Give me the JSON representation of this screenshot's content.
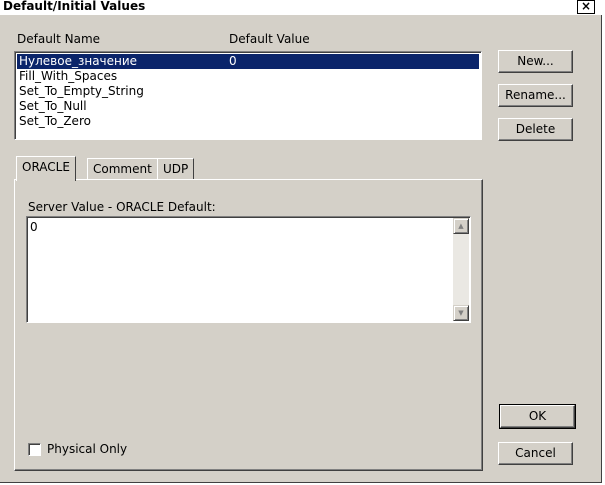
{
  "window": {
    "title": "Default/Initial Values",
    "close_glyph": "×"
  },
  "list": {
    "header_name": "Default Name",
    "header_value": "Default Value",
    "rows": [
      {
        "name": "Нулевое_значение",
        "value": "0",
        "selected": true
      },
      {
        "name": "Fill_With_Spaces",
        "value": ""
      },
      {
        "name": "Set_To_Empty_String",
        "value": ""
      },
      {
        "name": "Set_To_Null",
        "value": ""
      },
      {
        "name": "Set_To_Zero",
        "value": ""
      }
    ]
  },
  "buttons": {
    "new_label": "New...",
    "rename_label": "Rename...",
    "delete_label": "Delete",
    "ok_label": "OK",
    "cancel_label": "Cancel"
  },
  "tabs": [
    {
      "label": "ORACLE",
      "active": true
    },
    {
      "label": "Comment"
    },
    {
      "label": "UDP"
    }
  ],
  "server_value": {
    "label": "Server Value - ORACLE Default:",
    "text": "0"
  },
  "physical_only": {
    "label": "Physical Only",
    "checked": false
  },
  "colors": {
    "dialog_bg": "#d4d0c8",
    "selection": "#0a246a"
  }
}
